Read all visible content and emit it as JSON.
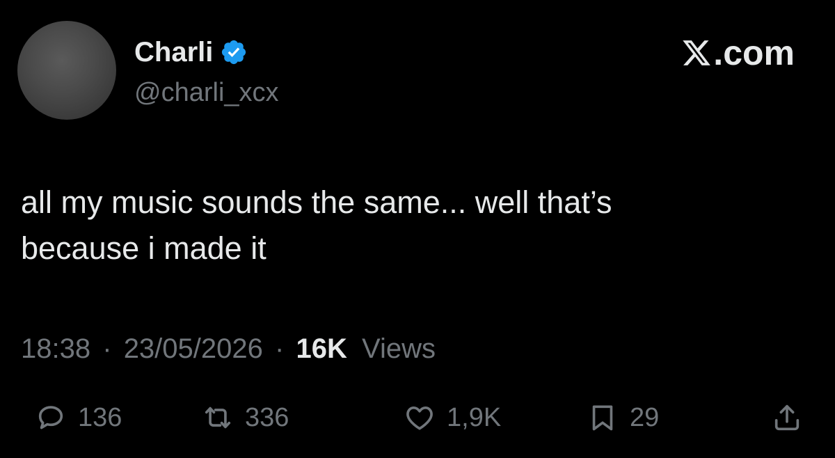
{
  "author": {
    "display_name": "Charli",
    "handle": "@charli_xcx",
    "verified_icon": "verified-badge-icon",
    "verified_color": "#1d9bf0"
  },
  "brand": {
    "label": ".com",
    "icon": "x-logo-icon"
  },
  "tweet": {
    "text": "all my music sounds the same... well that’s\nbecause i made it"
  },
  "meta": {
    "time": "18:38",
    "separator": "·",
    "date": "23/05/2026",
    "views_count": "16K",
    "views_label": "Views"
  },
  "actions": {
    "reply": {
      "icon": "reply-icon",
      "count": "136"
    },
    "repost": {
      "icon": "repost-icon",
      "count": "336"
    },
    "like": {
      "icon": "heart-icon",
      "count": "1,9K"
    },
    "bookmark": {
      "icon": "bookmark-icon",
      "count": "29"
    },
    "share": {
      "icon": "share-icon"
    }
  },
  "colors": {
    "background": "#000000",
    "primary_text": "#e7e9ea",
    "secondary_text": "#71767b"
  }
}
